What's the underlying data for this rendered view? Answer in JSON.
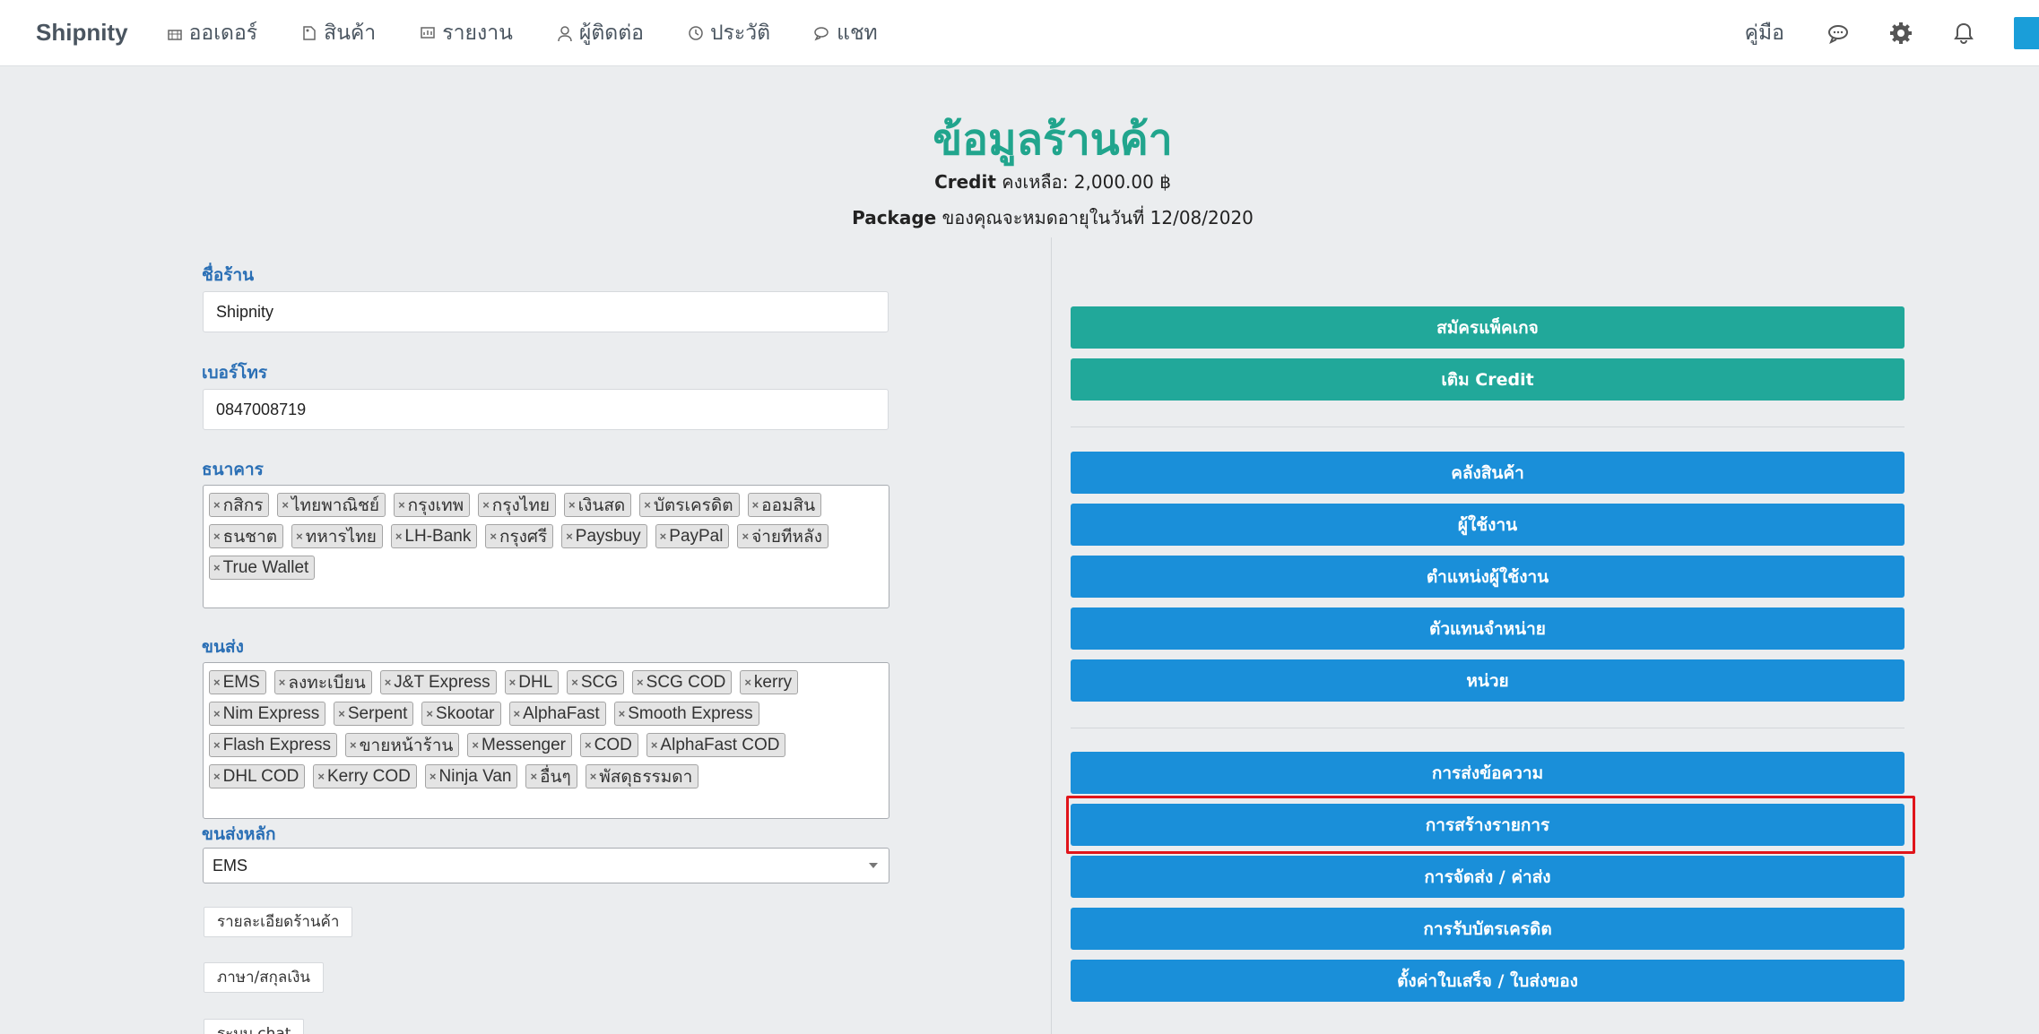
{
  "nav": {
    "brand": "Shipnity",
    "items": [
      {
        "label": "ออเดอร์",
        "icon": "basket-icon"
      },
      {
        "label": "สินค้า",
        "icon": "tag-icon"
      },
      {
        "label": "รายงาน",
        "icon": "chart-icon"
      },
      {
        "label": "ผู้ติดต่อ",
        "icon": "user-icon"
      },
      {
        "label": "ประวัติ",
        "icon": "history-icon"
      },
      {
        "label": "แชท",
        "icon": "chat-icon"
      }
    ],
    "manual": "คู่มือ"
  },
  "header": {
    "title": "ข้อมูลร้านค้า",
    "credit_label": "Credit",
    "credit_text": " คงเหลือ: 2,000.00 ฿",
    "package_label": "Package",
    "package_text": " ของคุณจะหมดอายุในวันที่ 12/08/2020"
  },
  "form": {
    "shop_name_label": "ชื่อร้าน",
    "shop_name_value": "Shipnity",
    "phone_label": "เบอร์โทร",
    "phone_value": "0847008719",
    "bank_label": "ธนาคาร",
    "banks": [
      "กสิกร",
      "ไทยพาณิชย์",
      "กรุงเทพ",
      "กรุงไทย",
      "เงินสด",
      "บัตรเครดิต",
      "ออมสิน",
      "ธนชาต",
      "ทหารไทย",
      "LH-Bank",
      "กรุงศรี",
      "Paysbuy",
      "PayPal",
      "จ่ายทีหลัง",
      "True Wallet"
    ],
    "shipping_label": "ขนส่ง",
    "shippings": [
      "EMS",
      "ลงทะเบียน",
      "J&T Express",
      "DHL",
      "SCG",
      "SCG COD",
      "kerry",
      "Nim Express",
      "Serpent",
      "Skootar",
      "AlphaFast",
      "Smooth Express",
      "Flash Express",
      "ขายหน้าร้าน",
      "Messenger",
      "COD",
      "AlphaFast COD",
      "DHL COD",
      "Kerry COD",
      "Ninja Van",
      "อื่นๆ",
      "พัสดุธรรมดา"
    ],
    "main_shipping_label": "ขนส่งหลัก",
    "main_shipping_value": "EMS",
    "shop_detail_button": "รายละเอียดร้านค้า",
    "language_button": "ภาษา/สกุลเงิน",
    "chat_button": "ระบบ chat"
  },
  "actions": {
    "group1": [
      "สมัครแพ็คเกจ",
      "เติม Credit"
    ],
    "group2": [
      "คลังสินค้า",
      "ผู้ใช้งาน",
      "ตำแหน่งผู้ใช้งาน",
      "ตัวแทนจำหน่าย",
      "หน่วย"
    ],
    "group3": [
      "การส่งข้อความ",
      "การสร้างรายการ",
      "การจัดส่ง / ค่าส่ง",
      "การรับบัตรเครดิต",
      "ตั้งค่าใบเสร็จ / ใบส่งของ"
    ]
  },
  "colors": {
    "accent_green": "#21a89a",
    "accent_blue": "#1a8fd9",
    "title_green": "#21a58d",
    "highlight_red": "#e0151b"
  }
}
